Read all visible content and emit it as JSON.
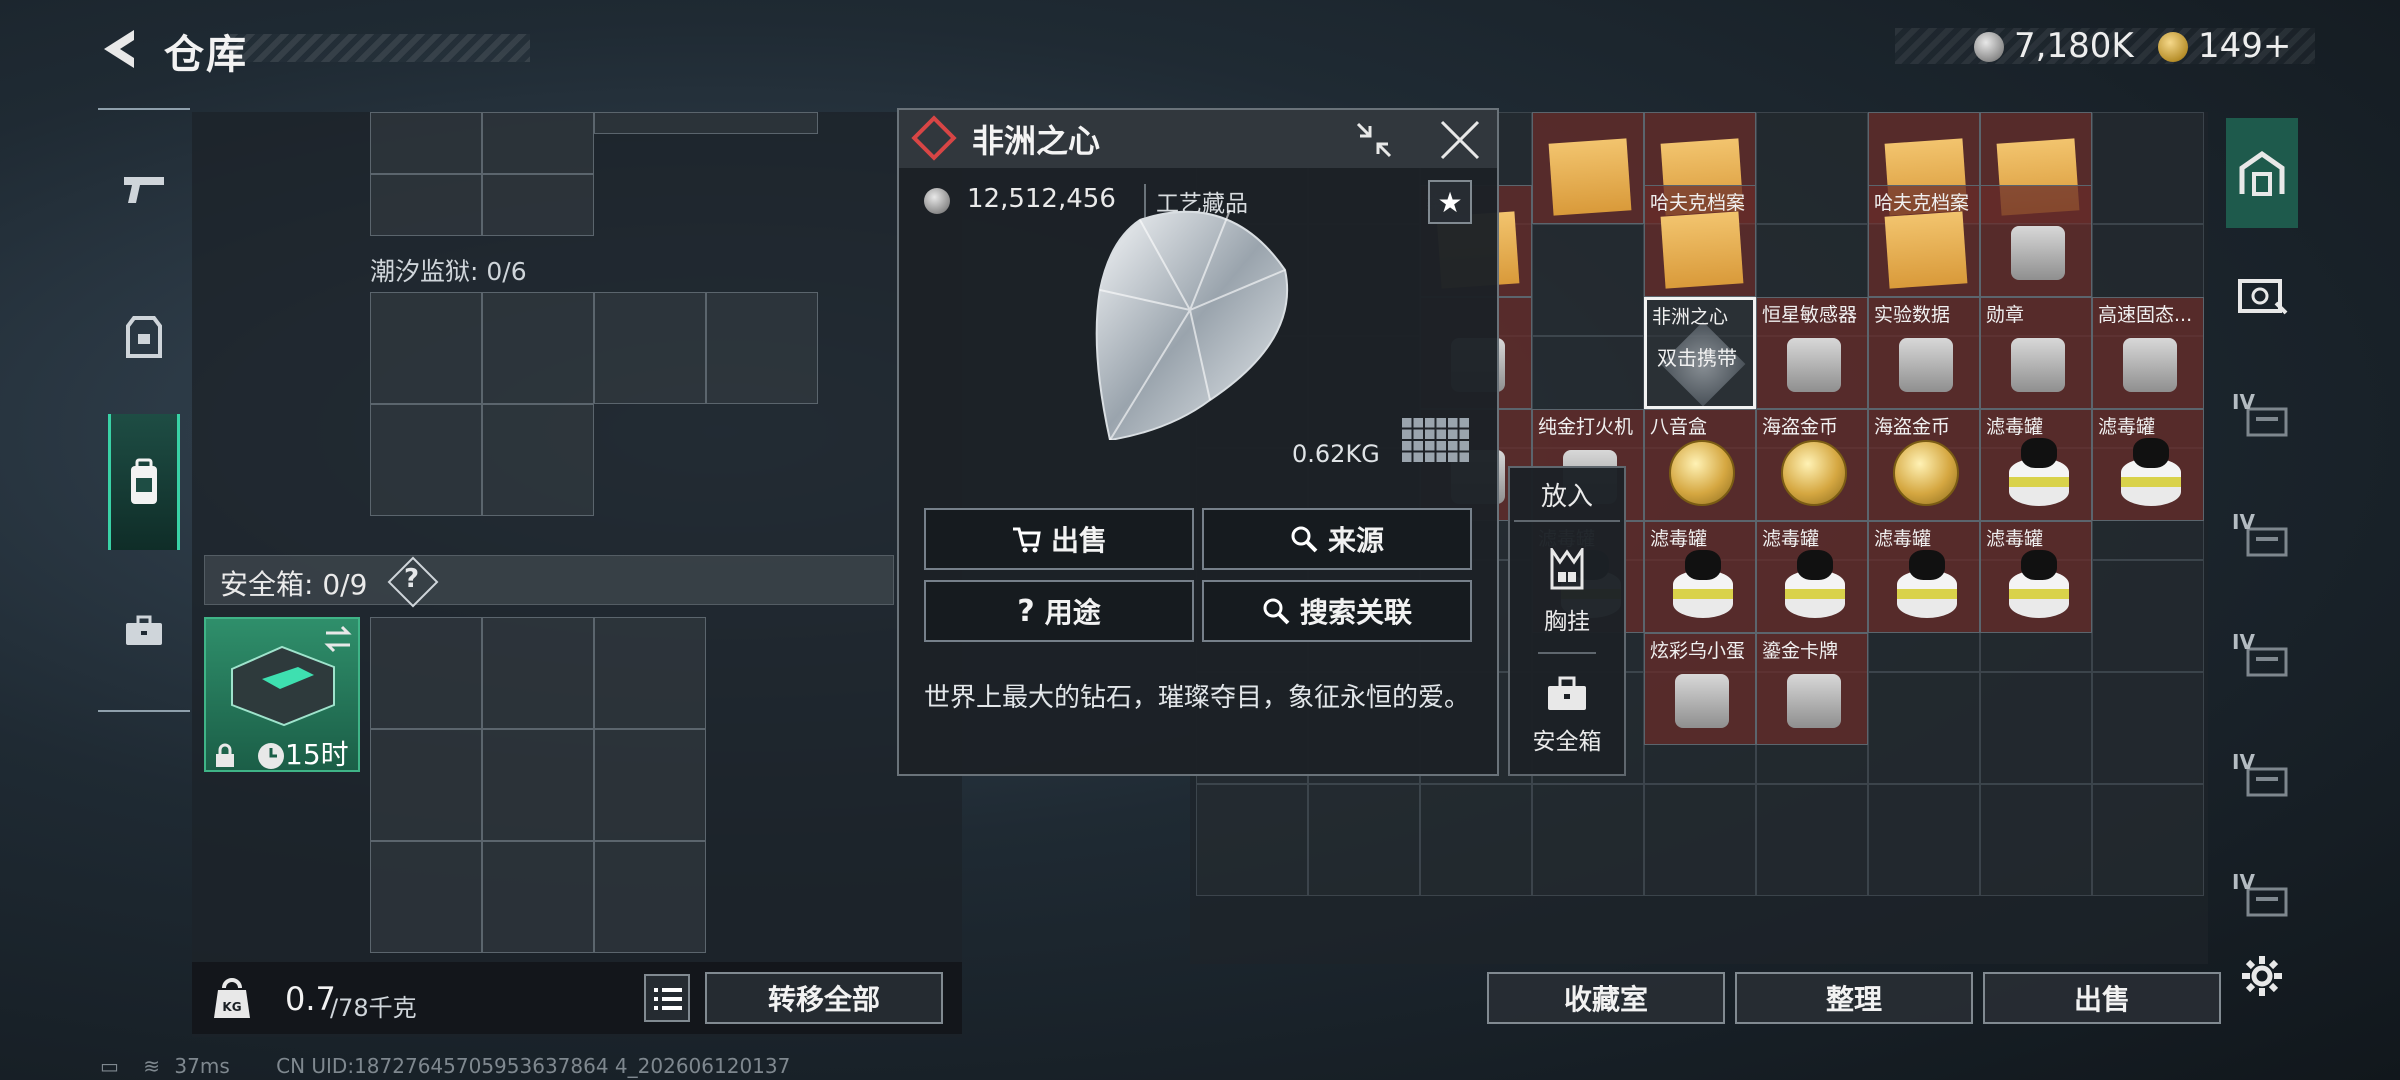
{
  "header": {
    "title": "仓库",
    "silver_amount": "7,180K",
    "gold_amount": "149+"
  },
  "gear_panel": {
    "tide_prison_label": "潮汐监狱: 0/6",
    "safe_box_label": "安全箱: 0/9",
    "safe_box_help": "?",
    "safe_box_timer": "15时"
  },
  "weight": {
    "current": "0.7",
    "max": "/78千克",
    "icon_text": "KG",
    "transfer_all": "转移全部"
  },
  "popup": {
    "title": "非洲之心",
    "price": "12,512,456",
    "category": "工艺藏品",
    "weight": "0.62KG",
    "buttons": {
      "sell": "出售",
      "source": "来源",
      "usage": "用途",
      "search_related": "搜索关联"
    },
    "description": "世界上最大的钻石，璀璨夺目，象征永恒的爱。"
  },
  "put_menu": {
    "title": "放入",
    "options": [
      "胸挂",
      "安全箱"
    ]
  },
  "storage": {
    "items": [
      {
        "label": "",
        "style": "red"
      },
      {
        "label": "",
        "style": "red"
      },
      {
        "label": "",
        "style": "red"
      },
      {
        "label": "",
        "style": "red"
      },
      {
        "label": "案",
        "style": "red"
      },
      {
        "label": "哈夫克档案",
        "style": "red"
      },
      {
        "label": "哈夫克档案",
        "style": "red"
      },
      {
        "label": "",
        "style": "red"
      },
      {
        "label": "",
        "style": "red"
      },
      {
        "label": "非洲之心",
        "sub": "双击携带",
        "style": "dark"
      },
      {
        "label": "恒星敏感器",
        "style": "red"
      },
      {
        "label": "实验数据",
        "style": "red"
      },
      {
        "label": "勋章",
        "style": "red"
      },
      {
        "label": "高速固态...",
        "style": "red"
      },
      {
        "label": "机",
        "style": "red"
      },
      {
        "label": "纯金打火机",
        "style": "red"
      },
      {
        "label": "八音盒",
        "style": "red"
      },
      {
        "label": "海盗金币",
        "style": "red"
      },
      {
        "label": "海盗金币",
        "style": "red"
      },
      {
        "label": "滤毒罐",
        "style": "red"
      },
      {
        "label": "滤毒罐",
        "style": "red"
      },
      {
        "label": "滤毒罐",
        "style": "red"
      },
      {
        "label": "滤毒罐",
        "style": "red"
      },
      {
        "label": "滤毒罐",
        "style": "red"
      },
      {
        "label": "滤毒罐",
        "style": "red"
      },
      {
        "label": "滤毒罐",
        "style": "red"
      },
      {
        "label": "炫彩乌小蛋",
        "style": "red"
      },
      {
        "label": "鎏金卡牌",
        "style": "red"
      }
    ],
    "buttons": {
      "collection": "收藏室",
      "organize": "整理",
      "sell": "出售"
    }
  },
  "right_tabs": [
    "IV",
    "IV",
    "IV",
    "IV",
    "IV"
  ],
  "footer": {
    "ping": "37ms",
    "uid": "CN UID:18727645705953637864 4_202606120137"
  },
  "colors": {
    "accent": "#39d2a6",
    "rarity_red": "#682c2a",
    "logo_red": "#d84545"
  }
}
